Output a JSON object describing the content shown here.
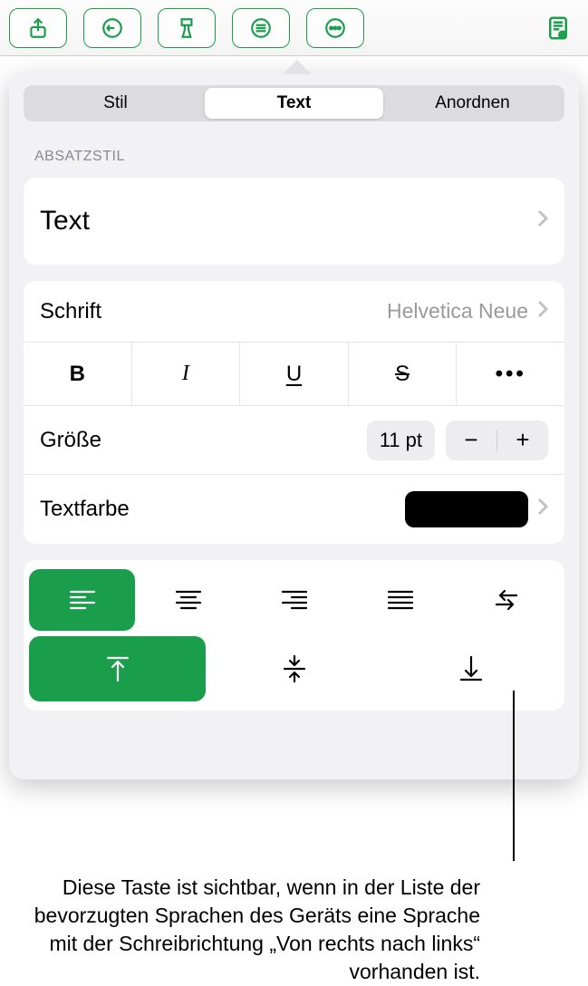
{
  "toolbar": {
    "share": "share-icon",
    "undo": "undo-icon",
    "format": "format-brush-icon",
    "wrap": "wrap-text-icon",
    "more": "more-icon",
    "preview": "document-preview-icon"
  },
  "tabs": {
    "style": "Stil",
    "text": "Text",
    "arrange": "Anordnen",
    "active": "text"
  },
  "sections": {
    "paragraph_style_label": "Absatzstil"
  },
  "paragraph_style": {
    "value": "Text"
  },
  "font": {
    "label": "Schrift",
    "value": "Helvetica Neue",
    "bold": "B",
    "italic": "I",
    "underline": "U",
    "strike": "S",
    "more": "•••"
  },
  "size": {
    "label": "Größe",
    "value": "11 pt",
    "minus": "−",
    "plus": "+"
  },
  "text_color": {
    "label": "Textfarbe",
    "value_hex": "#000000"
  },
  "alignment": {
    "horizontal_selected": "left",
    "vertical_selected": "top"
  },
  "caption": "Diese Taste ist sichtbar, wenn in der Liste der bevorzugten Sprachen des Geräts eine Sprache mit der Schreibrichtung „Von rechts nach links“ vorhanden ist."
}
